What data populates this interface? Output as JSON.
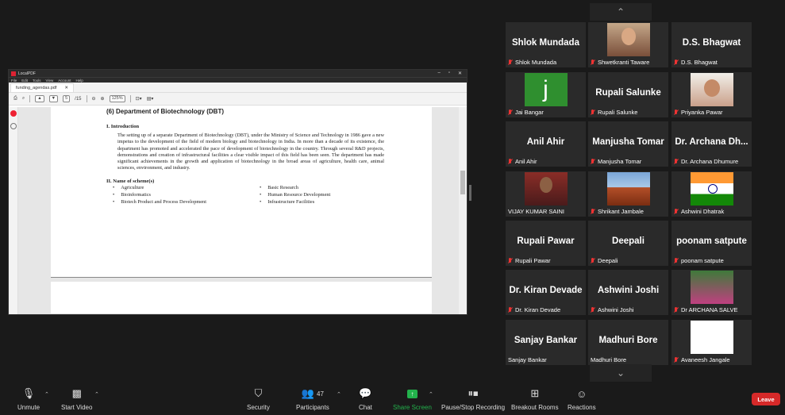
{
  "pdf": {
    "app_title": "LocalPDF",
    "menu": [
      "File",
      "Edit",
      "Tools",
      "View",
      "Account",
      "Help"
    ],
    "tab_name": "funding_agendas.pdf",
    "tab_close": "✕",
    "page_current": "5",
    "page_total": "/15",
    "zoom": "125%",
    "window_controls": [
      "–",
      "▫",
      "✕"
    ]
  },
  "document": {
    "heading": "(6) Department of Biotechnology (DBT)",
    "section1_title": "I. Introduction",
    "section1_text": "The setting up of a separate Department of Biotechnology (DBT), under the Ministry of Science and Technology in 1986 gave a new impetus to the development of the field of modern biology and biotechnology in India. In more than a decade of its existence, the department has promoted and accelerated the pace of development of biotechnology in the country. Through several R&D projects, demonstrations and creation of infrastructural facilities a clear visible impact of this field has been seen. The department has made significant achievements in the growth and application of biotechnology in the broad areas of agriculture, health care, animal sciences, environment, and industry.",
    "section2_title": "II. Name of scheme(s)",
    "schemes": [
      "Agriculture",
      "Basic Research",
      "Bioinformatics",
      "Human Resource Development",
      "Biotech Product and Process Development",
      "Infrastructure Facilities"
    ]
  },
  "participants": [
    {
      "display": "Shlok Mundada",
      "label": "Shlok Mundada",
      "muted": true,
      "video": "none"
    },
    {
      "display": "",
      "label": "Shwetkranti Taware",
      "muted": true,
      "video": "woman"
    },
    {
      "display": "D.S. Bhagwat",
      "label": "D.S. Bhagwat",
      "muted": true,
      "video": "none"
    },
    {
      "display": "",
      "label": "Jai Bangar",
      "muted": true,
      "video": "green-j"
    },
    {
      "display": "Rupali Salunke",
      "label": "Rupali Salunke",
      "muted": true,
      "video": "none"
    },
    {
      "display": "",
      "label": "Priyanka Pawar",
      "muted": true,
      "video": "woman2"
    },
    {
      "display": "Anil Ahir",
      "label": "Anil Ahir",
      "muted": true,
      "video": "none"
    },
    {
      "display": "Manjusha Tomar",
      "label": "Manjusha Tomar",
      "muted": true,
      "video": "none"
    },
    {
      "display": "Dr. Archana Dh...",
      "label": "Dr. Archana Dhumure",
      "muted": true,
      "video": "none"
    },
    {
      "display": "",
      "label": "VIJAY KUMAR SAINI",
      "muted": false,
      "video": "man"
    },
    {
      "display": "",
      "label": "Shrikant Jambale",
      "muted": true,
      "video": "rock"
    },
    {
      "display": "",
      "label": "Ashwini Dhatrak",
      "muted": true,
      "video": "flag"
    },
    {
      "display": "Rupali Pawar",
      "label": "Rupali Pawar",
      "muted": true,
      "video": "none"
    },
    {
      "display": "Deepali",
      "label": "Deepali",
      "muted": true,
      "video": "none"
    },
    {
      "display": "poonam satpute",
      "label": "poonam satpute",
      "muted": true,
      "video": "none"
    },
    {
      "display": "Dr. Kiran Devade",
      "label": "Dr. Kiran Devade",
      "muted": true,
      "video": "none"
    },
    {
      "display": "Ashwini Joshi",
      "label": "Ashwini Joshi",
      "muted": true,
      "video": "none"
    },
    {
      "display": "",
      "label": "Dr ARCHANA SALVE",
      "muted": true,
      "video": "lady"
    },
    {
      "display": "Sanjay Bankar",
      "label": "Sanjay Bankar",
      "muted": false,
      "video": "none"
    },
    {
      "display": "Madhuri Bore",
      "label": "Madhuri Bore",
      "muted": false,
      "video": "none"
    },
    {
      "display": "",
      "label": "Avaneesh Jangale",
      "muted": true,
      "video": "white"
    }
  ],
  "toolbar": {
    "unmute": "Unmute",
    "start_video": "Start Video",
    "security": "Security",
    "participants": "Participants",
    "participants_count": "47",
    "chat": "Chat",
    "share_screen": "Share Screen",
    "recording": "Pause/Stop Recording",
    "breakout": "Breakout Rooms",
    "reactions": "Reactions",
    "leave": "Leave"
  },
  "colors": {
    "background": "#1a1a1a",
    "tile": "#2a2a2a",
    "muted_red": "#e33333",
    "share_green": "#23b24c",
    "leave_red": "#d62929"
  }
}
